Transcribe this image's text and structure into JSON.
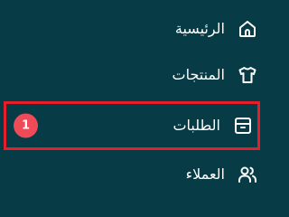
{
  "sidebar": {
    "items": [
      {
        "label": "الرئيسية",
        "icon": "home-icon"
      },
      {
        "label": "المنتجات",
        "icon": "shirt-icon"
      },
      {
        "label": "الطلبات",
        "icon": "box-icon",
        "badge": "1",
        "highlighted": true
      },
      {
        "label": "العملاء",
        "icon": "users-icon"
      }
    ]
  },
  "colors": {
    "background": "#073b46",
    "highlight_border": "#e51e2a",
    "badge": "#ef4a57",
    "text": "#ffffff"
  }
}
